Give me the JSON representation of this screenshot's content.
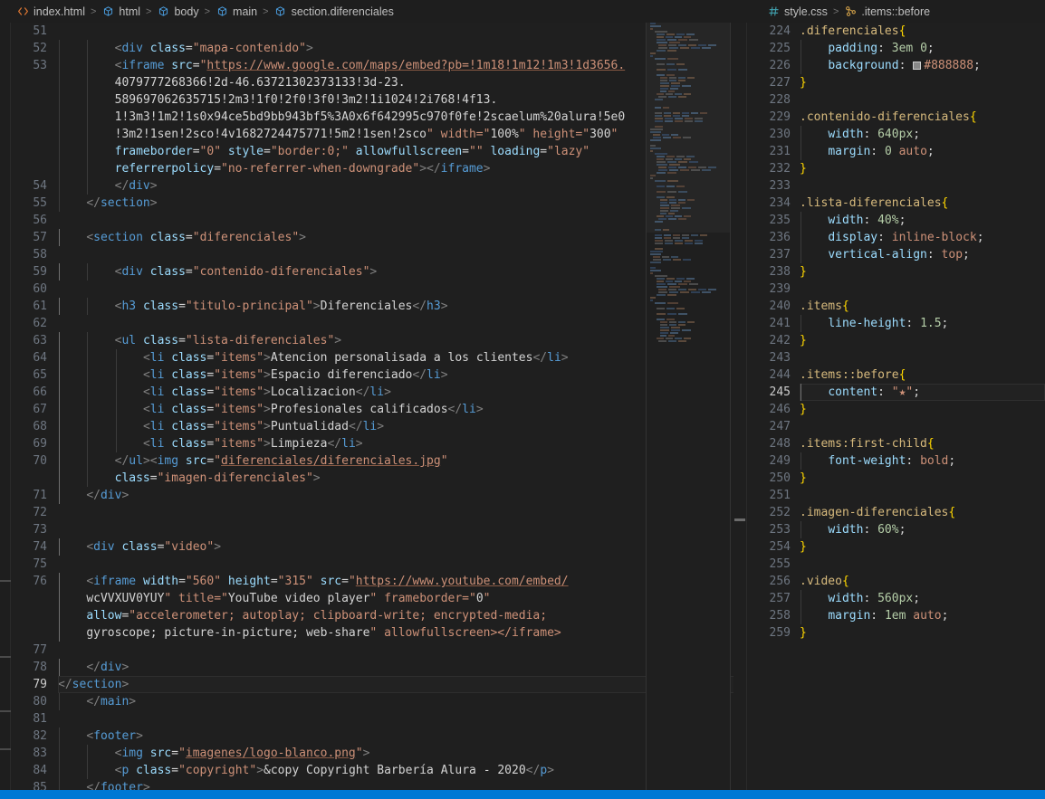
{
  "window": {
    "status_bar_color": "#0078d4",
    "editor_background": "#1f1f1f"
  },
  "left_editor": {
    "breadcrumb": {
      "items": [
        {
          "icon": "html-file-icon",
          "label": "index.html"
        },
        {
          "icon": "symbol-cube-icon",
          "label": "html"
        },
        {
          "icon": "symbol-cube-icon",
          "label": "body"
        },
        {
          "icon": "symbol-cube-icon",
          "label": "main"
        },
        {
          "icon": "symbol-cube-icon",
          "label": "section.diferenciales"
        }
      ],
      "separator": ">"
    },
    "first_line_number": 51,
    "current_line": 79,
    "lines": [
      {
        "n": 51,
        "text": ""
      },
      {
        "n": 52,
        "text": "        <div class=\"mapa-contenido\">"
      },
      {
        "n": 53,
        "text": "        <iframe src=\"https://www.google.com/maps/embed?pb=!1m18!1m12!1m3!1d3656.4079777268366!2d-46.63721302373133!3d-23.589697062635715!2m3!1f0!2f0!3f0!3m2!1i1024!2i768!4f13.1!3m3!1m2!1s0x94ce5bd9bb943bf5%3A0x6f642995c970f0fe!2scaelum%20alura!5e0!3m2!1sen!2sco!4v1682724475771!5m2!1sen!2sco\" width=\"100%\" height=\"300\" frameborder=\"0\" style=\"border:0;\" allowfullscreen=\"\" loading=\"lazy\" referrerpolicy=\"no-referrer-when-downgrade\"></iframe>"
      },
      {
        "n": 54,
        "text": "        </div>"
      },
      {
        "n": 55,
        "text": "    </section>"
      },
      {
        "n": 56,
        "text": ""
      },
      {
        "n": 57,
        "text": "    <section class=\"diferenciales\">"
      },
      {
        "n": 58,
        "text": ""
      },
      {
        "n": 59,
        "text": "        <div class=\"contenido-diferenciales\">"
      },
      {
        "n": 60,
        "text": ""
      },
      {
        "n": 61,
        "text": "        <h3 class=\"titulo-principal\">Diferenciales</h3>"
      },
      {
        "n": 62,
        "text": ""
      },
      {
        "n": 63,
        "text": "        <ul class=\"lista-diferenciales\">"
      },
      {
        "n": 64,
        "text": "            <li class=\"items\">Atencion personalisada a los clientes</li>"
      },
      {
        "n": 65,
        "text": "            <li class=\"items\">Espacio diferenciado</li>"
      },
      {
        "n": 66,
        "text": "            <li class=\"items\">Localizacion</li>"
      },
      {
        "n": 67,
        "text": "            <li class=\"items\">Profesionales calificados</li>"
      },
      {
        "n": 68,
        "text": "            <li class=\"items\">Puntualidad</li>"
      },
      {
        "n": 69,
        "text": "            <li class=\"items\">Limpieza</li>"
      },
      {
        "n": 70,
        "text": "        </ul><img src=\"diferenciales/diferenciales.jpg\" class=\"imagen-diferenciales\">"
      },
      {
        "n": 71,
        "text": "    </div>"
      },
      {
        "n": 72,
        "text": ""
      },
      {
        "n": 73,
        "text": ""
      },
      {
        "n": 74,
        "text": "    <div class=\"video\">"
      },
      {
        "n": 75,
        "text": ""
      },
      {
        "n": 76,
        "text": "    <iframe width=\"560\" height=\"315\" src=\"https://www.youtube.com/embed/wcVVXUV0YUY\" title=\"YouTube video player\" frameborder=\"0\" allow=\"accelerometer; autoplay; clipboard-write; encrypted-media; gyroscope; picture-in-picture; web-share\" allowfullscreen></iframe>"
      },
      {
        "n": 77,
        "text": ""
      },
      {
        "n": 78,
        "text": "    </div>"
      },
      {
        "n": 79,
        "text": "</section>"
      },
      {
        "n": 80,
        "text": "    </main>"
      },
      {
        "n": 81,
        "text": ""
      },
      {
        "n": 82,
        "text": "    <footer>"
      },
      {
        "n": 83,
        "text": "        <img src=\"imagenes/logo-blanco.png\">"
      },
      {
        "n": 84,
        "text": "        <p class=\"copyright\">&copy Copyright Barbería Alura - 2020</p>"
      },
      {
        "n": 85,
        "text": "    </footer>"
      }
    ]
  },
  "right_editor": {
    "breadcrumb": {
      "items": [
        {
          "icon": "css-hash-icon",
          "label": "style.css"
        },
        {
          "icon": "css-selector-icon",
          "label": ".items::before"
        }
      ],
      "separator": ">"
    },
    "first_line_number": 224,
    "current_line": 245,
    "rules": [
      {
        "n": 224,
        "type": "selector",
        "text": ".diferenciales{"
      },
      {
        "n": 225,
        "type": "decl",
        "prop": "padding",
        "value": "3em 0",
        "value_kind": "num"
      },
      {
        "n": 226,
        "type": "decl-color",
        "prop": "background",
        "value": "#888888",
        "swatch": "#888888"
      },
      {
        "n": 227,
        "type": "close",
        "text": "}"
      },
      {
        "n": 228,
        "type": "blank",
        "text": ""
      },
      {
        "n": 229,
        "type": "selector",
        "text": ".contenido-diferenciales{"
      },
      {
        "n": 230,
        "type": "decl",
        "prop": "width",
        "value": "640px",
        "value_kind": "num"
      },
      {
        "n": 231,
        "type": "decl",
        "prop": "margin",
        "value": "0 auto",
        "value_kind": "mixed"
      },
      {
        "n": 232,
        "type": "close",
        "text": "}"
      },
      {
        "n": 233,
        "type": "blank",
        "text": ""
      },
      {
        "n": 234,
        "type": "selector",
        "text": ".lista-diferenciales{"
      },
      {
        "n": 235,
        "type": "decl",
        "prop": "width",
        "value": "40%",
        "value_kind": "num"
      },
      {
        "n": 236,
        "type": "decl",
        "prop": "display",
        "value": "inline-block",
        "value_kind": "kw"
      },
      {
        "n": 237,
        "type": "decl",
        "prop": "vertical-align",
        "value": "top",
        "value_kind": "kw"
      },
      {
        "n": 238,
        "type": "close",
        "text": "}"
      },
      {
        "n": 239,
        "type": "blank",
        "text": ""
      },
      {
        "n": 240,
        "type": "selector",
        "text": ".items{"
      },
      {
        "n": 241,
        "type": "decl",
        "prop": "line-height",
        "value": "1.5",
        "value_kind": "num"
      },
      {
        "n": 242,
        "type": "close",
        "text": "}"
      },
      {
        "n": 243,
        "type": "blank",
        "text": ""
      },
      {
        "n": 244,
        "type": "selector",
        "text": ".items::before{"
      },
      {
        "n": 245,
        "type": "decl",
        "prop": "content",
        "value": "\"★\"",
        "value_kind": "str"
      },
      {
        "n": 246,
        "type": "close",
        "text": "}"
      },
      {
        "n": 247,
        "type": "blank",
        "text": ""
      },
      {
        "n": 248,
        "type": "selector",
        "text": ".items:first-child{"
      },
      {
        "n": 249,
        "type": "decl",
        "prop": "font-weight",
        "value": "bold",
        "value_kind": "kw"
      },
      {
        "n": 250,
        "type": "close",
        "text": "}"
      },
      {
        "n": 251,
        "type": "blank",
        "text": ""
      },
      {
        "n": 252,
        "type": "selector",
        "text": ".imagen-diferenciales{"
      },
      {
        "n": 253,
        "type": "decl",
        "prop": "width",
        "value": "60%",
        "value_kind": "num"
      },
      {
        "n": 254,
        "type": "close",
        "text": "}"
      },
      {
        "n": 255,
        "type": "blank",
        "text": ""
      },
      {
        "n": 256,
        "type": "selector",
        "text": ".video{"
      },
      {
        "n": 257,
        "type": "decl",
        "prop": "width",
        "value": "560px",
        "value_kind": "num"
      },
      {
        "n": 258,
        "type": "decl",
        "prop": "margin",
        "value": "1em auto",
        "value_kind": "mixed"
      },
      {
        "n": 259,
        "type": "close",
        "text": "}"
      }
    ]
  }
}
